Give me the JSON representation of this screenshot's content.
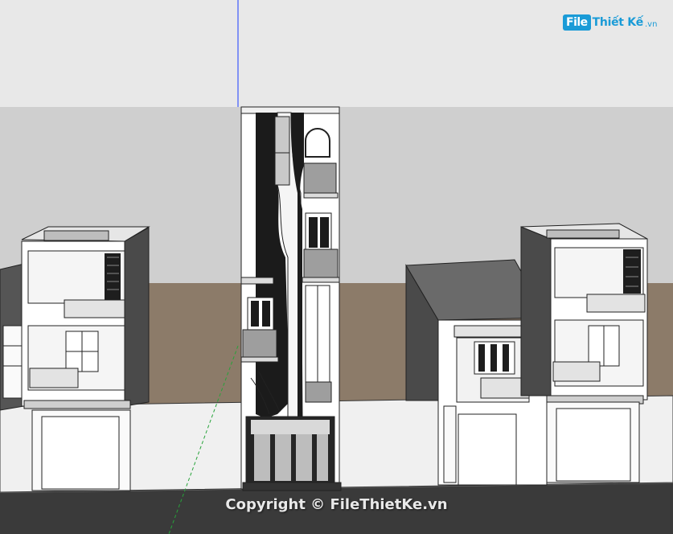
{
  "logo": {
    "badge": "File",
    "text": "Thiết Kế",
    "suffix": ".vn"
  },
  "watermark": {
    "text": "Copyright © FileThietKe.vn"
  },
  "colors": {
    "sky": "#e4e4e4",
    "ground": "#8a7a68",
    "wall": "#c9c9c9",
    "facade": "#ffffff",
    "dark": "#1b1b1b",
    "glass": "#9a9a9a",
    "road": "#3b3b3b",
    "axis_blue": "#1a3cff",
    "axis_green": "#27a33a",
    "brand": "#1a9bd7"
  },
  "icons": {
    "logo": "filethietke-logo"
  }
}
